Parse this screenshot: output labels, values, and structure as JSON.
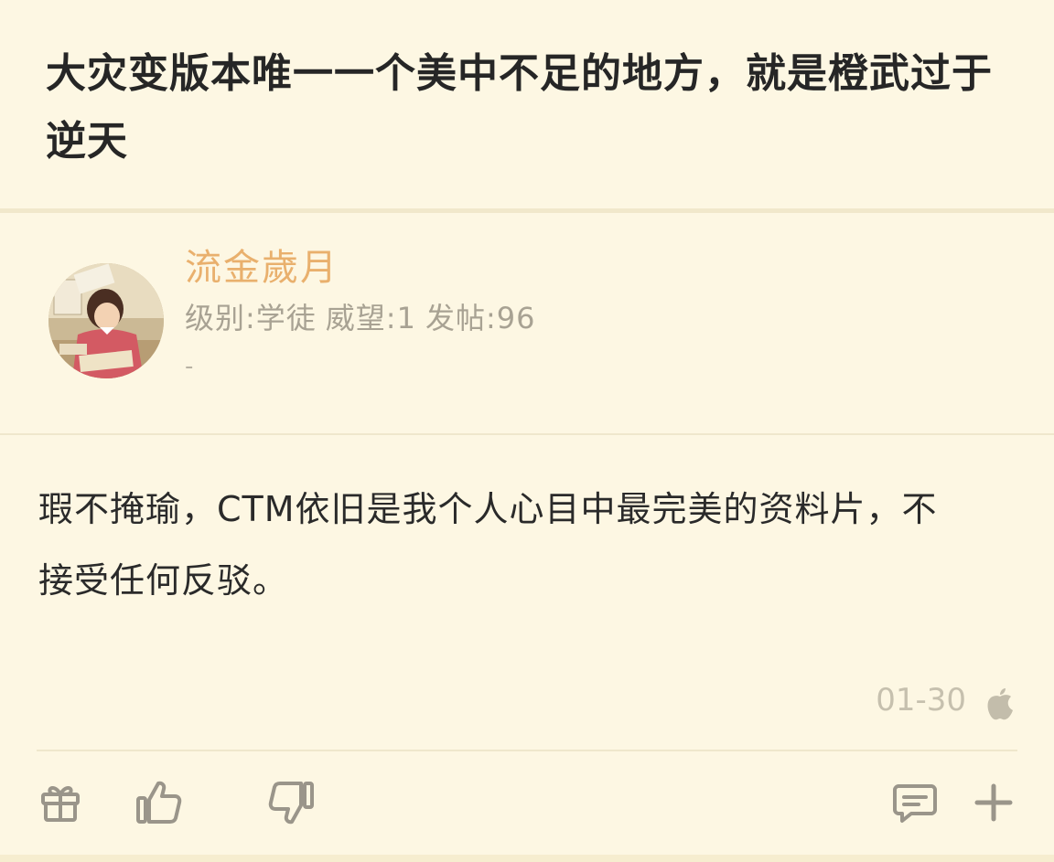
{
  "post": {
    "title": "大灾变版本唯一一个美中不足的地方，就是橙武过于逆天",
    "content": "瑕不掩瑜，CTM依旧是我个人心目中最完美的资料片，不接受任何反驳。",
    "date": "01-30"
  },
  "author": {
    "name": "流金歲月",
    "level": "级别:学徒",
    "prestige": "威望:1",
    "posts": "发帖:96",
    "signature": "-"
  },
  "icons": {
    "device": "apple-icon",
    "gift": "gift-icon",
    "like": "thumbs-up-icon",
    "dislike": "thumbs-down-icon",
    "reply": "comment-icon",
    "more": "plus-icon"
  },
  "colors": {
    "background": "#fdf7e3",
    "username": "#e9b06d",
    "meta": "#a8a293",
    "icon": "#9a958a"
  }
}
